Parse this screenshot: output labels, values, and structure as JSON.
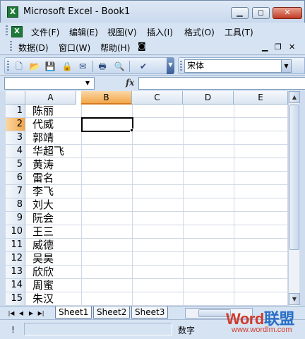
{
  "window": {
    "title": "Microsoft Excel - Book1",
    "app_icon": "excel-icon"
  },
  "window_buttons": {
    "minimize": "▁",
    "restore": "◻",
    "close": "✕"
  },
  "menu": {
    "row1": [
      "文件(F)",
      "编辑(E)",
      "视图(V)",
      "插入(I)",
      "格式(O)",
      "工具(T)"
    ],
    "row2": [
      "数据(D)",
      "窗口(W)",
      "帮助(H)"
    ],
    "mdi_minimize": "▁",
    "mdi_restore": "❐",
    "mdi_close": "✕"
  },
  "toolbar": {
    "icons": [
      "new-icon",
      "open-icon",
      "save-icon",
      "permission-icon",
      "email-icon",
      "print-icon",
      "print-preview-icon",
      "spelling-icon"
    ],
    "glyphs": [
      "🗋",
      "📂",
      "💾",
      "🔒",
      "✉",
      "🖶",
      "🔍",
      "✔"
    ]
  },
  "font": {
    "name": "宋体",
    "arrow": "▼"
  },
  "formula_bar": {
    "name_box": "",
    "fx": "fx",
    "formula": ""
  },
  "grid": {
    "columns": [
      "A",
      "B",
      "C",
      "D",
      "E"
    ],
    "active_column": "B",
    "rows": [
      "1",
      "2",
      "3",
      "4",
      "5",
      "6",
      "7",
      "8",
      "9",
      "10",
      "11",
      "12",
      "13",
      "14",
      "15"
    ],
    "active_row": "2",
    "column_a": [
      "陈丽",
      "代威",
      "郭靖",
      "华超飞",
      "黄涛",
      "雷名",
      "李飞",
      "刘大",
      "阮会",
      "王三",
      "威德",
      "吴昊",
      "欣欣",
      "周蜜",
      "朱汉"
    ]
  },
  "sheets": {
    "tabs": [
      "Sheet1",
      "Sheet2",
      "Sheet3"
    ],
    "active": "Sheet1",
    "nav": [
      "|◀",
      "◀",
      "▶",
      "▶|"
    ]
  },
  "status": {
    "indicator": "!",
    "mode": "数字"
  },
  "watermark": {
    "logo_a": "Word",
    "logo_b": "联盟",
    "url": "www.wordlm.com"
  }
}
